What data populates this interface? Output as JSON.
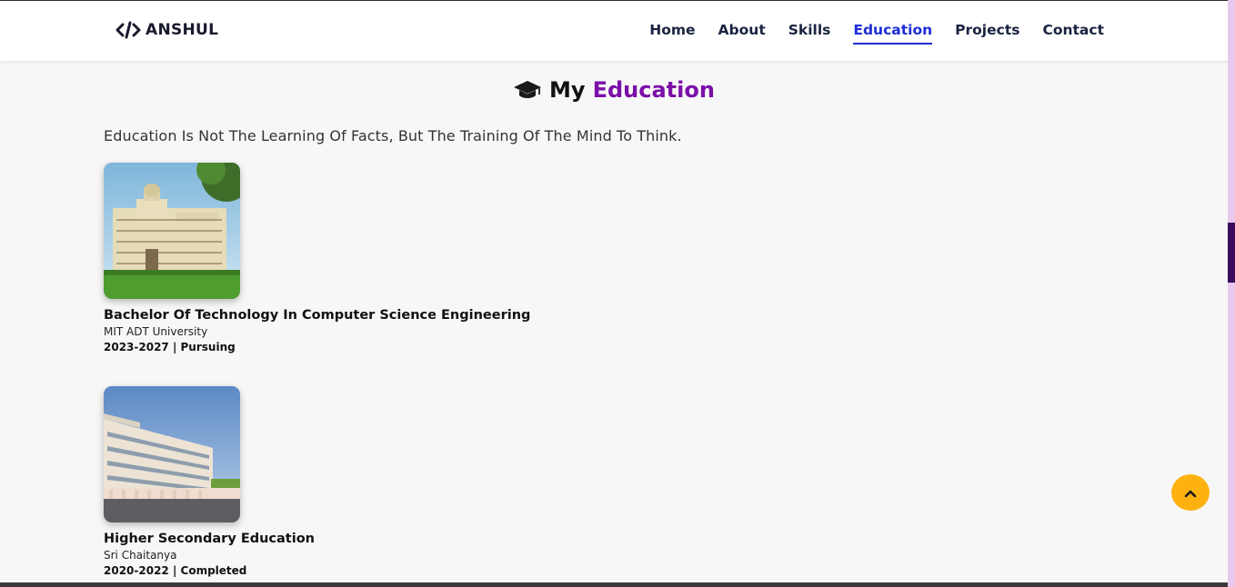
{
  "brand": {
    "logo_symbol": "</>",
    "name": "ANSHUL"
  },
  "nav": {
    "items": [
      "Home",
      "About",
      "Skills",
      "Education",
      "Projects",
      "Contact"
    ],
    "active": "Education"
  },
  "section": {
    "icon": "graduation-cap-icon",
    "heading_prefix": "My",
    "heading_highlight": "Education",
    "quote": "Education Is Not The Learning Of Facts, But The Training Of The Mind To Think."
  },
  "education": [
    {
      "title": "Bachelor Of Technology In Computer Science Engineering",
      "institution": "MIT ADT University",
      "period": "2023-2027 | Pursuing"
    },
    {
      "title": "Higher Secondary Education",
      "institution": "Sri Chaitanya",
      "period": "2020-2022 | Completed"
    }
  ],
  "scroll_top": {
    "icon": "chevron-up-icon"
  },
  "colors": {
    "accent_purple": "#7b0fa8",
    "nav_active": "#1d2ed6",
    "scroll_button": "#fdb20f",
    "scrollbar_thumb": "#3b0a5c"
  }
}
